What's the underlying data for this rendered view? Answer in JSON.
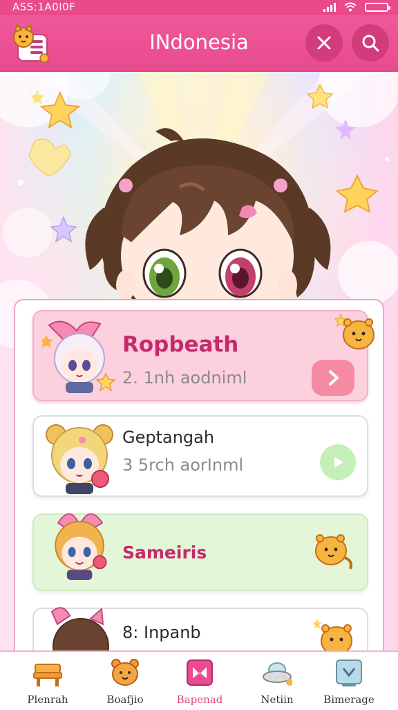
{
  "status_bar": {
    "time": "ASS:1A0I0F",
    "icons": [
      "signal-icon",
      "wifi-icon",
      "battery-icon"
    ]
  },
  "header": {
    "title": "INdonesia",
    "logo_icon": "cat-menu-logo-icon",
    "close_icon": "close-icon",
    "search_icon": "search-icon"
  },
  "colors": {
    "brand": "#e84a8c",
    "active_tab": "#e0427f",
    "card_pink": "#fcd0dc",
    "card_green": "#e4f6d8"
  },
  "list": {
    "items": [
      {
        "name": "Ropbeath",
        "sub": "2. 1nh aodniml",
        "action_icon": "chevron-right-icon"
      },
      {
        "name": "Geptangah",
        "sub": "3 5rch aorInml",
        "action_icon": "play-icon"
      },
      {
        "name": "Sameiris",
        "sub": ""
      },
      {
        "name": "8: Inpanb",
        "sub": ""
      }
    ]
  },
  "bottom_nav": {
    "items": [
      {
        "label": "Plenrah",
        "icon": "bench-icon"
      },
      {
        "label": "Boafjio",
        "icon": "bear-icon"
      },
      {
        "label": "Bapenad",
        "icon": "bookmark-heart-icon"
      },
      {
        "label": "Netiin",
        "icon": "ufo-icon"
      },
      {
        "label": "Bimerage",
        "icon": "frame-icon"
      }
    ],
    "active_index": 2
  }
}
